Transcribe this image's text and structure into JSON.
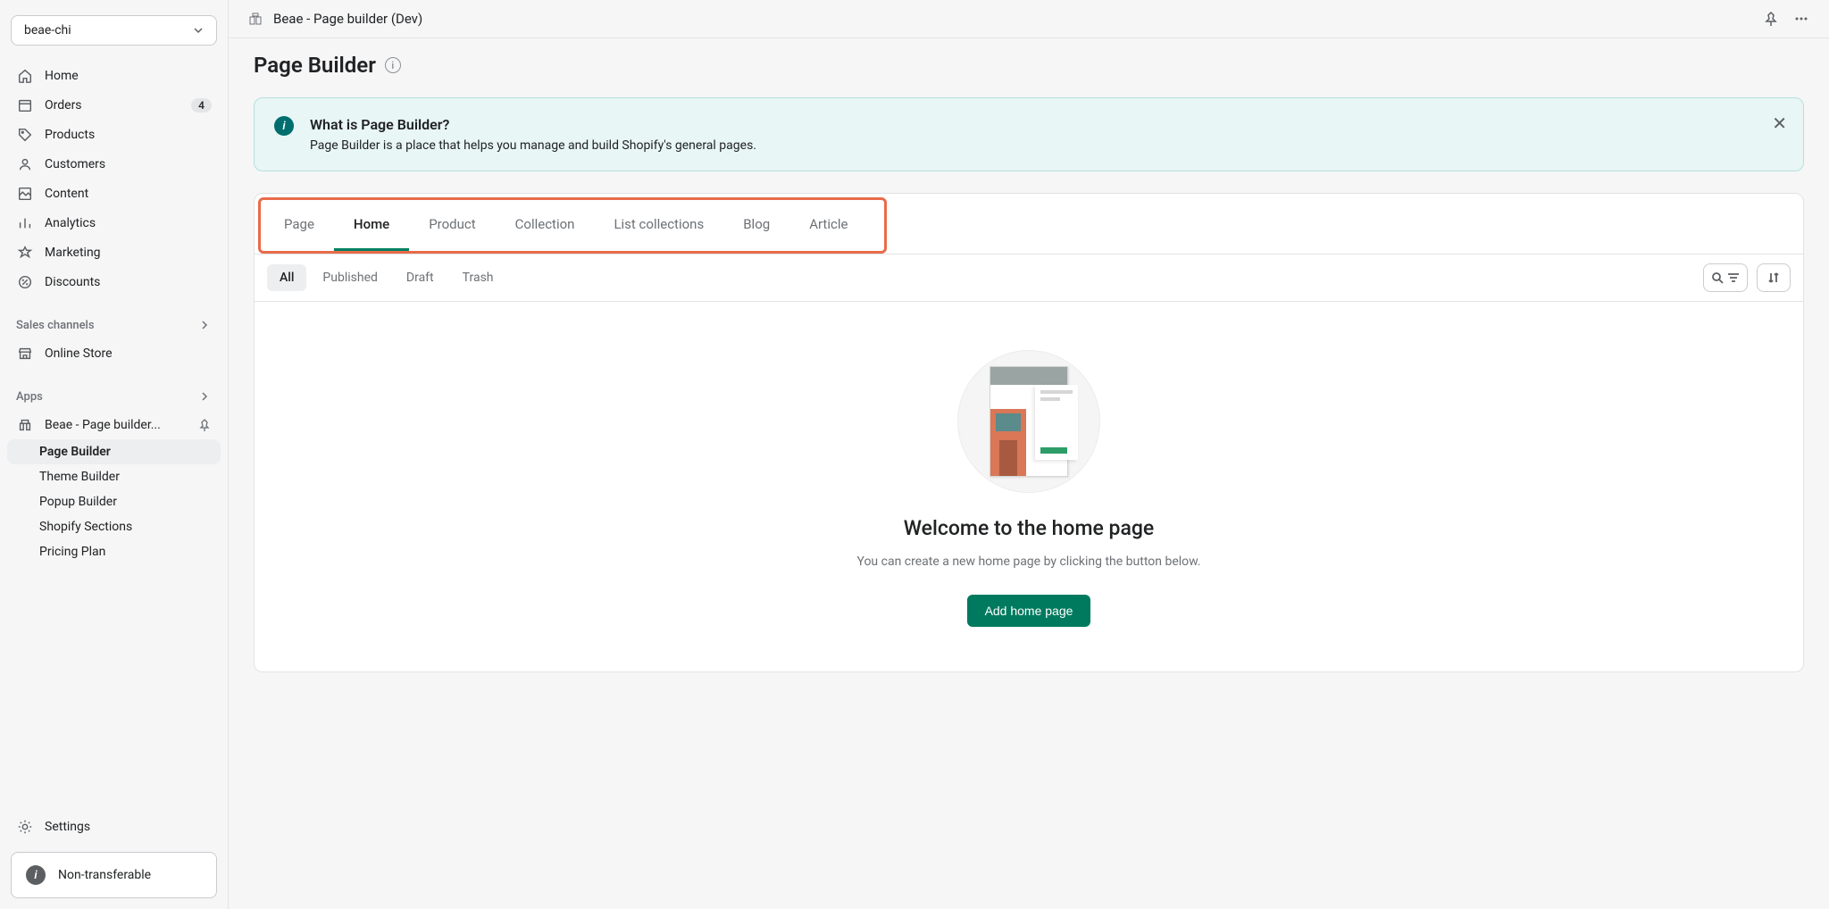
{
  "store": {
    "name": "beae-chi"
  },
  "sidebar": {
    "items": [
      {
        "label": "Home"
      },
      {
        "label": "Orders",
        "badge": "4"
      },
      {
        "label": "Products"
      },
      {
        "label": "Customers"
      },
      {
        "label": "Content"
      },
      {
        "label": "Analytics"
      },
      {
        "label": "Marketing"
      },
      {
        "label": "Discounts"
      }
    ],
    "sales_channels_title": "Sales channels",
    "online_store_label": "Online Store",
    "apps_title": "Apps",
    "app_name": "Beae - Page builder...",
    "app_subnav": [
      "Page Builder",
      "Theme Builder",
      "Popup Builder",
      "Shopify Sections",
      "Pricing Plan"
    ],
    "settings_label": "Settings",
    "non_transferable_label": "Non-transferable"
  },
  "topbar": {
    "breadcrumb": "Beae - Page builder (Dev)"
  },
  "page": {
    "title": "Page Builder"
  },
  "banner": {
    "title": "What is Page Builder?",
    "description": "Page Builder is a place that helps you manage and build Shopify's general pages."
  },
  "tabs": {
    "items": [
      "Page",
      "Home",
      "Product",
      "Collection",
      "List collections",
      "Blog",
      "Article"
    ],
    "active_index": 1
  },
  "filters": {
    "items": [
      "All",
      "Published",
      "Draft",
      "Trash"
    ],
    "active_index": 0
  },
  "empty_state": {
    "title": "Welcome to the home page",
    "description": "You can create a new home page by clicking the button below.",
    "button_label": "Add home page"
  }
}
